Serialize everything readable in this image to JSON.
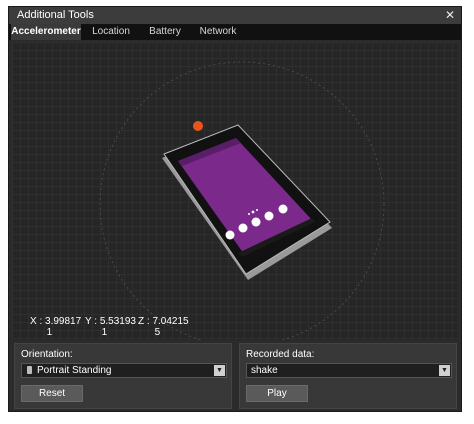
{
  "window": {
    "title": "Additional Tools",
    "close_glyph": "✕"
  },
  "tabs": [
    {
      "label": "Accelerometer",
      "active": true
    },
    {
      "label": "Location",
      "active": false
    },
    {
      "label": "Battery",
      "active": false
    },
    {
      "label": "Network",
      "active": false
    }
  ],
  "readout": {
    "x": "X : 3.99817\n      1",
    "y": "Y : 5.53193\n      1",
    "z": "Z : 7.04215\n      5"
  },
  "orientation": {
    "label": "Orientation:",
    "selected": "Portrait Standing",
    "icon": "phone-portrait-icon",
    "reset_label": "Reset"
  },
  "recorded": {
    "label": "Recorded data:",
    "selected": "shake",
    "play_label": "Play"
  },
  "colors": {
    "accent_dot": "#e8541a",
    "screen": "#7b2a8c"
  }
}
